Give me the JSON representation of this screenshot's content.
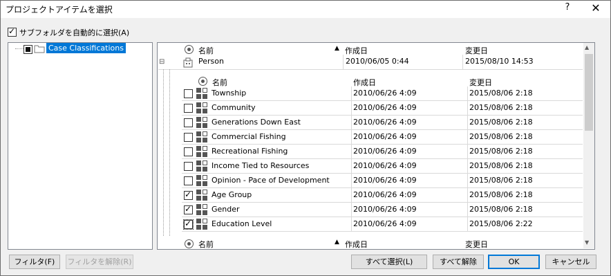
{
  "window": {
    "title": "プロジェクトアイテムを選択",
    "help": "?",
    "close": "✕"
  },
  "auto_select": {
    "label": "サブフォルダを自動的に選択(A)",
    "checked": true
  },
  "tree": {
    "root_label": "Case Classifications"
  },
  "columns": {
    "name": "名前",
    "created": "作成日",
    "modified": "変更日"
  },
  "parent_row": {
    "name": "Person",
    "created": "2010/06/05 0:44",
    "modified": "2015/08/10 14:53",
    "expander": "⊟"
  },
  "child_rows": [
    {
      "name": "Township",
      "created": "2010/06/26 4:09",
      "modified": "2015/08/06 2:18",
      "checked": false
    },
    {
      "name": "Community",
      "created": "2010/06/26 4:09",
      "modified": "2015/08/06 2:18",
      "checked": false
    },
    {
      "name": "Generations Down East",
      "created": "2010/06/26 4:09",
      "modified": "2015/08/06 2:18",
      "checked": false
    },
    {
      "name": "Commercial Fishing",
      "created": "2010/06/26 4:09",
      "modified": "2015/08/06 2:18",
      "checked": false
    },
    {
      "name": "Recreational Fishing",
      "created": "2010/06/26 4:09",
      "modified": "2015/08/06 2:18",
      "checked": false
    },
    {
      "name": "Income Tied to Resources",
      "created": "2010/06/26 4:09",
      "modified": "2015/08/06 2:18",
      "checked": false
    },
    {
      "name": "Opinion - Pace of Development",
      "created": "2010/06/26 4:09",
      "modified": "2015/08/06 2:18",
      "checked": false
    },
    {
      "name": "Age Group",
      "created": "2010/06/26 4:09",
      "modified": "2015/08/06 2:18",
      "checked": true
    },
    {
      "name": "Gender",
      "created": "2010/06/26 4:09",
      "modified": "2015/08/06 2:18",
      "checked": true
    },
    {
      "name": "Education Level",
      "created": "2010/06/26 4:09",
      "modified": "2015/08/06 2:22",
      "checked": true
    }
  ],
  "buttons": {
    "filter": "フィルタ(F)",
    "clear_filter": "フィルタを解除(R)",
    "select_all": "すべて選択(L)",
    "clear_all": "すべて解除",
    "ok": "OK",
    "cancel": "キャンセル"
  },
  "colors": {
    "selection": "#0078d7",
    "default_border": "#0078d7"
  }
}
